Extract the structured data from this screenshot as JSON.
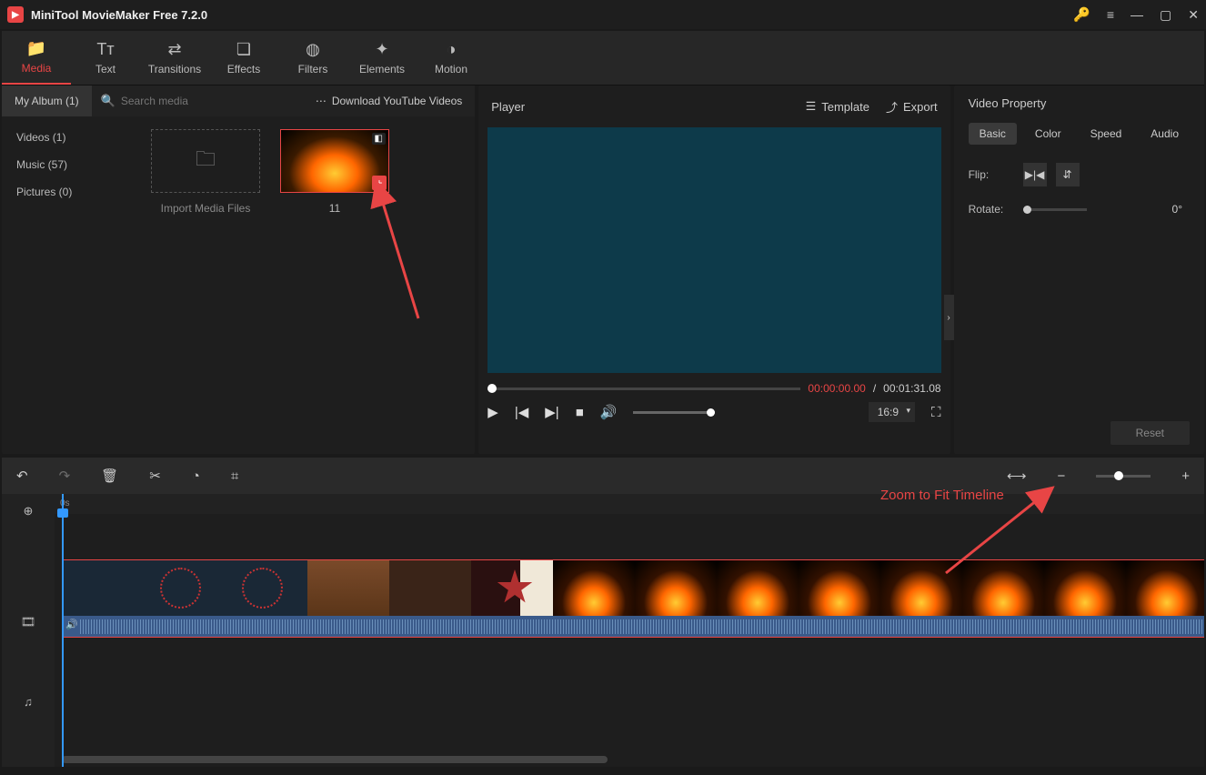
{
  "titlebar": {
    "app_title": "MiniTool MovieMaker Free 7.2.0"
  },
  "toolbar": {
    "media": "Media",
    "text": "Text",
    "transitions": "Transitions",
    "effects": "Effects",
    "filters": "Filters",
    "elements": "Elements",
    "motion": "Motion"
  },
  "media_panel": {
    "album_tab": "My Album (1)",
    "search_placeholder": "Search media",
    "download_link": "Download YouTube Videos",
    "sidebar": {
      "videos": "Videos (1)",
      "music": "Music (57)",
      "pictures": "Pictures (0)"
    },
    "import_label": "Import Media Files",
    "clip_name": "11"
  },
  "player": {
    "title": "Player",
    "template": "Template",
    "export": "Export",
    "time_current": "00:00:00.00",
    "time_sep": " / ",
    "time_total": "00:01:31.08",
    "aspect": "16:9"
  },
  "properties": {
    "title": "Video Property",
    "tabs": {
      "basic": "Basic",
      "color": "Color",
      "speed": "Speed",
      "audio": "Audio"
    },
    "flip_label": "Flip:",
    "rotate_label": "Rotate:",
    "rotate_value": "0°",
    "reset": "Reset"
  },
  "timeline": {
    "start_label": "0s"
  },
  "annotation": {
    "zoom_label": "Zoom to Fit Timeline"
  }
}
